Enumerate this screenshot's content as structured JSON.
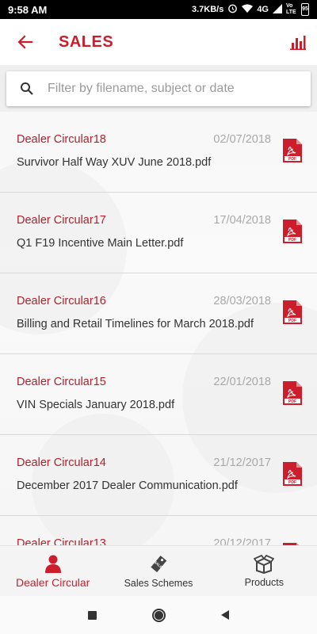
{
  "status_bar": {
    "time": "9:58 AM",
    "speed": "3.7KB/s",
    "network": "4G",
    "volte": "Vo LTE",
    "battery": "95"
  },
  "header": {
    "title": "SALES"
  },
  "search": {
    "placeholder": "Filter by filename, subject or date",
    "value": ""
  },
  "items": [
    {
      "title": "Dealer Circular18",
      "date": "02/07/2018",
      "file": "Survivor Half Way XUV June 2018.pdf"
    },
    {
      "title": "Dealer Circular17",
      "date": "17/04/2018",
      "file": "Q1 F19 Incentive Main Letter.pdf"
    },
    {
      "title": "Dealer Circular16",
      "date": "28/03/2018",
      "file": "Billing and Retail Timelines for March 2018.pdf"
    },
    {
      "title": "Dealer Circular15",
      "date": "22/01/2018",
      "file": "VIN Specials January 2018.pdf"
    },
    {
      "title": "Dealer Circular14",
      "date": "21/12/2017",
      "file": "December 2017 Dealer Communication.pdf"
    },
    {
      "title": "Dealer Circular13",
      "date": "20/12/2017",
      "file": ""
    }
  ],
  "pdf_badge": "PDF",
  "bottom_nav": {
    "dealer_circular": "Dealer Circular",
    "sales_schemes": "Sales Schemes",
    "sale_tag": "SALE",
    "products": "Products"
  },
  "colors": {
    "accent": "#cc1d2c"
  }
}
